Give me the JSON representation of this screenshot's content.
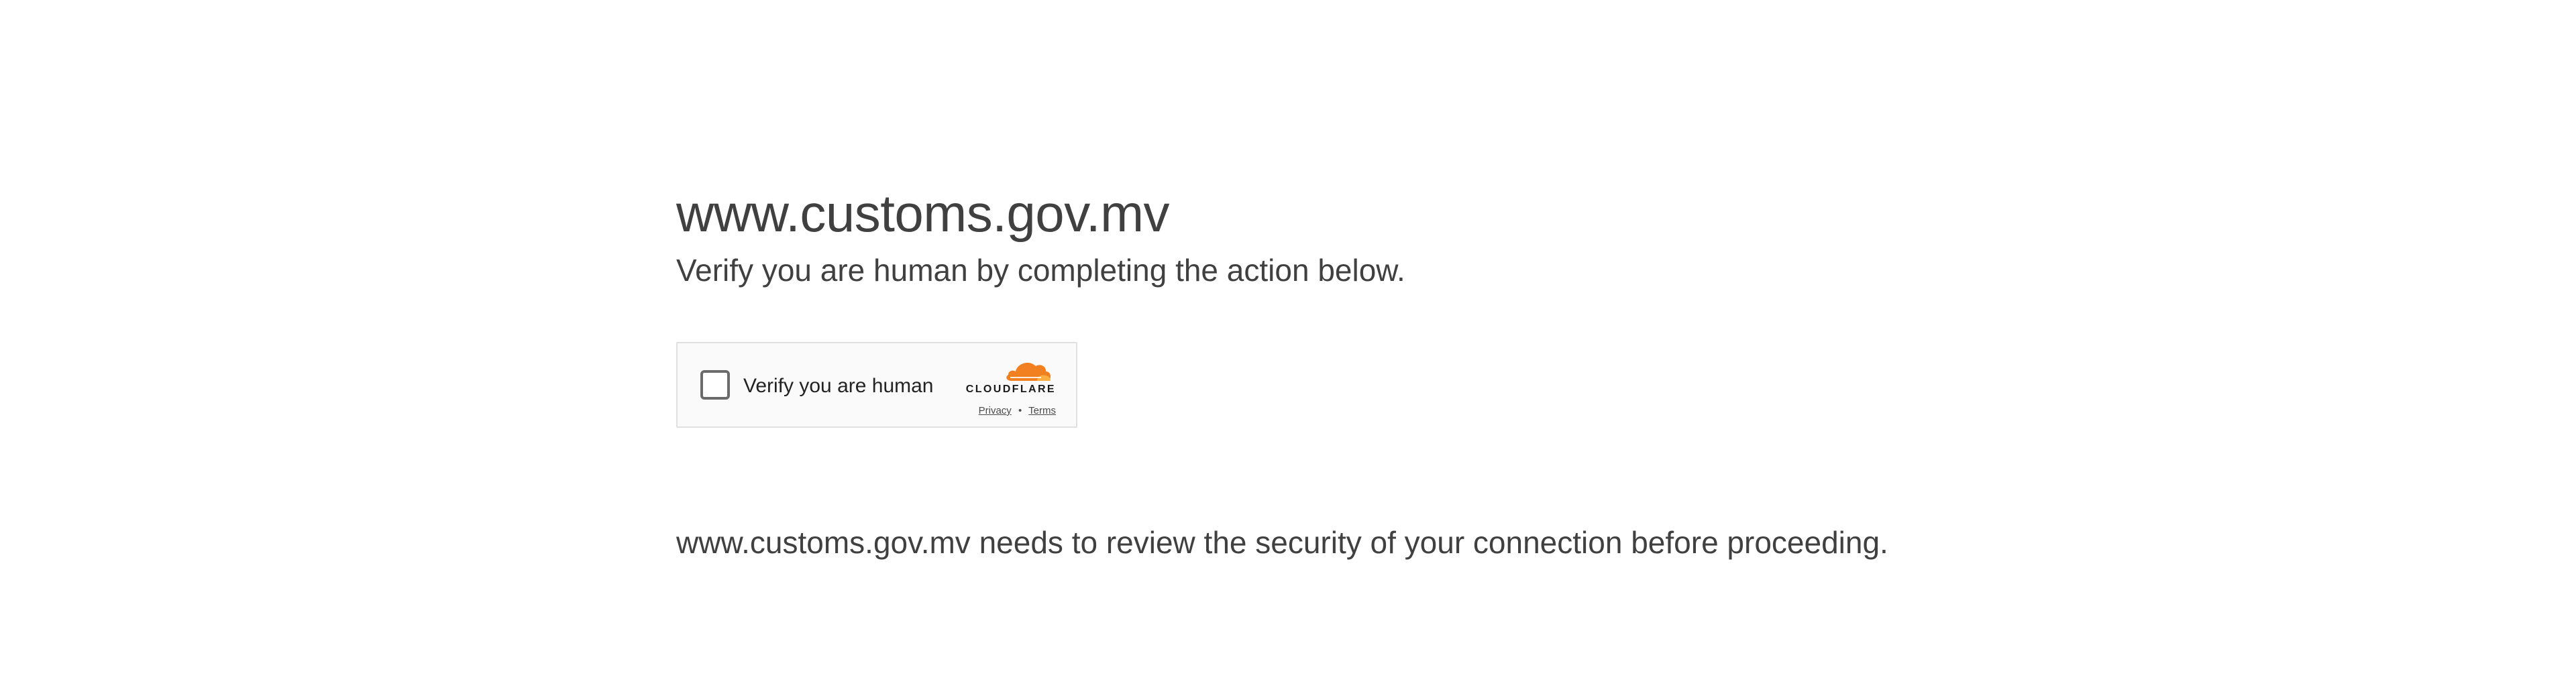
{
  "site": {
    "domain": "www.customs.gov.mv",
    "instruction": "Verify you are human by completing the action below."
  },
  "widget": {
    "checkbox_label": "Verify you are human",
    "brand": "CLOUDFLARE",
    "privacy_link": "Privacy",
    "separator": "•",
    "terms_link": "Terms",
    "brand_colors": {
      "orange": "#f38020",
      "light_orange": "#faae40"
    }
  },
  "footer": {
    "review_message": "www.customs.gov.mv needs to review the security of your connection before proceeding."
  }
}
